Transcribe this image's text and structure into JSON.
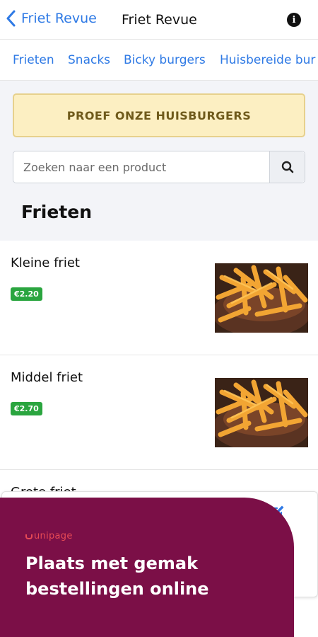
{
  "header": {
    "back_label": "Friet Revue",
    "title": "Friet Revue",
    "info_icon": "info-icon"
  },
  "categories": [
    "Frieten",
    "Snacks",
    "Bicky burgers",
    "Huisbereide bur"
  ],
  "promo_banner": "PROEF ONZE HUISBURGERS",
  "search": {
    "placeholder": "Zoeken naar een product"
  },
  "section_title": "Frieten",
  "products": [
    {
      "name": "Kleine friet",
      "price": "€2.20"
    },
    {
      "name": "Middel friet",
      "price": "€2.70"
    },
    {
      "name": "Grote friet"
    }
  ],
  "overlay": {
    "brand": "unipage",
    "headline_line1": "Plaats met gemak",
    "headline_line2": "bestellingen online"
  },
  "colors": {
    "link": "#2f7ae5",
    "promo_bg": "#fcefc2",
    "price_green": "#2aa53f",
    "overlay_bg": "#7b0f47",
    "brand_red": "#e74a55"
  }
}
